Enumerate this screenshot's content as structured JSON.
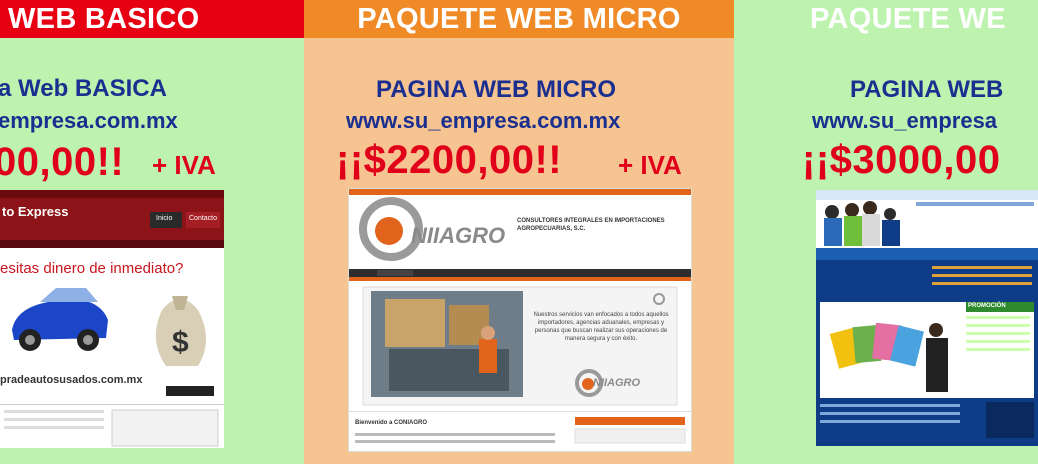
{
  "columns": [
    {
      "banner": "E WEB BASICO",
      "title": "a Web BASICA",
      "domain": "empresa.com.mx",
      "price": "00,00!!",
      "iva": "+ IVA",
      "mockup": {
        "logo": "to Express",
        "nav_item": "Inicio",
        "nav_item2": "Contacto",
        "headline": "esitas dinero de inmediato?",
        "url_text": "pradeautosusados.com.mx"
      }
    },
    {
      "banner": "PAQUETE WEB MICRO",
      "title": "PAGINA WEB MICRO",
      "domain": "www.su_empresa.com.mx",
      "price": "¡¡$2200,00!!",
      "iva": "+ IVA",
      "mockup": {
        "logo": "NIIAGRO",
        "company": "CONSULTORES INTEGRALES EN IMPORTACIONES AGROPECUARIAS, S.C.",
        "body_text": "Nuestros servicios van enfocados a todos aquellos importadores, agencias aduanales, empresas y personas que buscan realizar sus operaciones de manera segura y con éxito.",
        "welcome": "Bienvenido a CONIAGRO",
        "footer_logo": "NIIAGRO"
      }
    },
    {
      "banner": "PAQUETE WE",
      "title": "PAGINA WEB",
      "domain": "www.su_empresa",
      "price": "¡¡$3000,00",
      "iva": "",
      "mockup": {
        "section": "PROMOCIÓN"
      }
    }
  ],
  "colors": {
    "green_bg": "#bdf3ae",
    "orange_bg": "#f5c490",
    "red_banner": "#e60012",
    "orange_banner": "#ef8a27",
    "navy_text": "#1a2f8f",
    "red_text": "#e1001a"
  }
}
